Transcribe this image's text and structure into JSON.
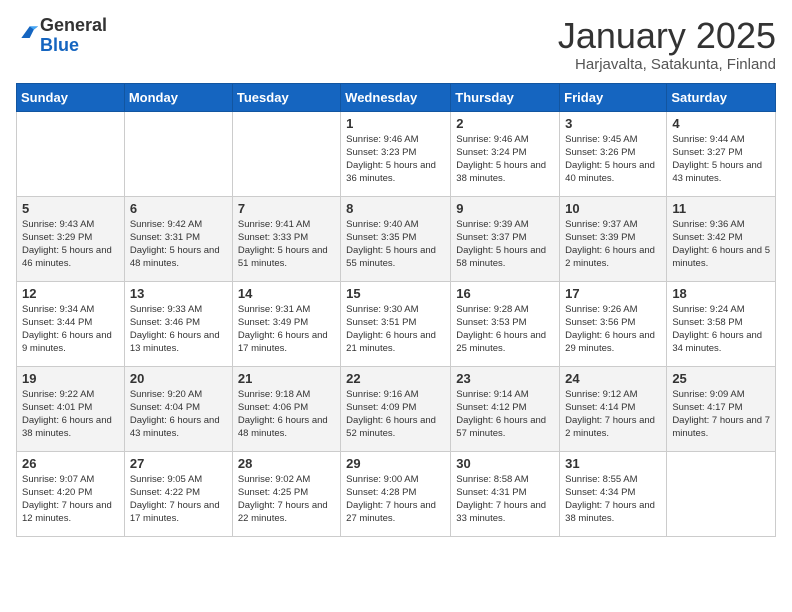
{
  "header": {
    "logo_general": "General",
    "logo_blue": "Blue",
    "title": "January 2025",
    "subtitle": "Harjavalta, Satakunta, Finland"
  },
  "days_of_week": [
    "Sunday",
    "Monday",
    "Tuesday",
    "Wednesday",
    "Thursday",
    "Friday",
    "Saturday"
  ],
  "weeks": [
    [
      {
        "num": "",
        "info": ""
      },
      {
        "num": "",
        "info": ""
      },
      {
        "num": "",
        "info": ""
      },
      {
        "num": "1",
        "info": "Sunrise: 9:46 AM\nSunset: 3:23 PM\nDaylight: 5 hours and 36 minutes."
      },
      {
        "num": "2",
        "info": "Sunrise: 9:46 AM\nSunset: 3:24 PM\nDaylight: 5 hours and 38 minutes."
      },
      {
        "num": "3",
        "info": "Sunrise: 9:45 AM\nSunset: 3:26 PM\nDaylight: 5 hours and 40 minutes."
      },
      {
        "num": "4",
        "info": "Sunrise: 9:44 AM\nSunset: 3:27 PM\nDaylight: 5 hours and 43 minutes."
      }
    ],
    [
      {
        "num": "5",
        "info": "Sunrise: 9:43 AM\nSunset: 3:29 PM\nDaylight: 5 hours and 46 minutes."
      },
      {
        "num": "6",
        "info": "Sunrise: 9:42 AM\nSunset: 3:31 PM\nDaylight: 5 hours and 48 minutes."
      },
      {
        "num": "7",
        "info": "Sunrise: 9:41 AM\nSunset: 3:33 PM\nDaylight: 5 hours and 51 minutes."
      },
      {
        "num": "8",
        "info": "Sunrise: 9:40 AM\nSunset: 3:35 PM\nDaylight: 5 hours and 55 minutes."
      },
      {
        "num": "9",
        "info": "Sunrise: 9:39 AM\nSunset: 3:37 PM\nDaylight: 5 hours and 58 minutes."
      },
      {
        "num": "10",
        "info": "Sunrise: 9:37 AM\nSunset: 3:39 PM\nDaylight: 6 hours and 2 minutes."
      },
      {
        "num": "11",
        "info": "Sunrise: 9:36 AM\nSunset: 3:42 PM\nDaylight: 6 hours and 5 minutes."
      }
    ],
    [
      {
        "num": "12",
        "info": "Sunrise: 9:34 AM\nSunset: 3:44 PM\nDaylight: 6 hours and 9 minutes."
      },
      {
        "num": "13",
        "info": "Sunrise: 9:33 AM\nSunset: 3:46 PM\nDaylight: 6 hours and 13 minutes."
      },
      {
        "num": "14",
        "info": "Sunrise: 9:31 AM\nSunset: 3:49 PM\nDaylight: 6 hours and 17 minutes."
      },
      {
        "num": "15",
        "info": "Sunrise: 9:30 AM\nSunset: 3:51 PM\nDaylight: 6 hours and 21 minutes."
      },
      {
        "num": "16",
        "info": "Sunrise: 9:28 AM\nSunset: 3:53 PM\nDaylight: 6 hours and 25 minutes."
      },
      {
        "num": "17",
        "info": "Sunrise: 9:26 AM\nSunset: 3:56 PM\nDaylight: 6 hours and 29 minutes."
      },
      {
        "num": "18",
        "info": "Sunrise: 9:24 AM\nSunset: 3:58 PM\nDaylight: 6 hours and 34 minutes."
      }
    ],
    [
      {
        "num": "19",
        "info": "Sunrise: 9:22 AM\nSunset: 4:01 PM\nDaylight: 6 hours and 38 minutes."
      },
      {
        "num": "20",
        "info": "Sunrise: 9:20 AM\nSunset: 4:04 PM\nDaylight: 6 hours and 43 minutes."
      },
      {
        "num": "21",
        "info": "Sunrise: 9:18 AM\nSunset: 4:06 PM\nDaylight: 6 hours and 48 minutes."
      },
      {
        "num": "22",
        "info": "Sunrise: 9:16 AM\nSunset: 4:09 PM\nDaylight: 6 hours and 52 minutes."
      },
      {
        "num": "23",
        "info": "Sunrise: 9:14 AM\nSunset: 4:12 PM\nDaylight: 6 hours and 57 minutes."
      },
      {
        "num": "24",
        "info": "Sunrise: 9:12 AM\nSunset: 4:14 PM\nDaylight: 7 hours and 2 minutes."
      },
      {
        "num": "25",
        "info": "Sunrise: 9:09 AM\nSunset: 4:17 PM\nDaylight: 7 hours and 7 minutes."
      }
    ],
    [
      {
        "num": "26",
        "info": "Sunrise: 9:07 AM\nSunset: 4:20 PM\nDaylight: 7 hours and 12 minutes."
      },
      {
        "num": "27",
        "info": "Sunrise: 9:05 AM\nSunset: 4:22 PM\nDaylight: 7 hours and 17 minutes."
      },
      {
        "num": "28",
        "info": "Sunrise: 9:02 AM\nSunset: 4:25 PM\nDaylight: 7 hours and 22 minutes."
      },
      {
        "num": "29",
        "info": "Sunrise: 9:00 AM\nSunset: 4:28 PM\nDaylight: 7 hours and 27 minutes."
      },
      {
        "num": "30",
        "info": "Sunrise: 8:58 AM\nSunset: 4:31 PM\nDaylight: 7 hours and 33 minutes."
      },
      {
        "num": "31",
        "info": "Sunrise: 8:55 AM\nSunset: 4:34 PM\nDaylight: 7 hours and 38 minutes."
      },
      {
        "num": "",
        "info": ""
      }
    ]
  ]
}
